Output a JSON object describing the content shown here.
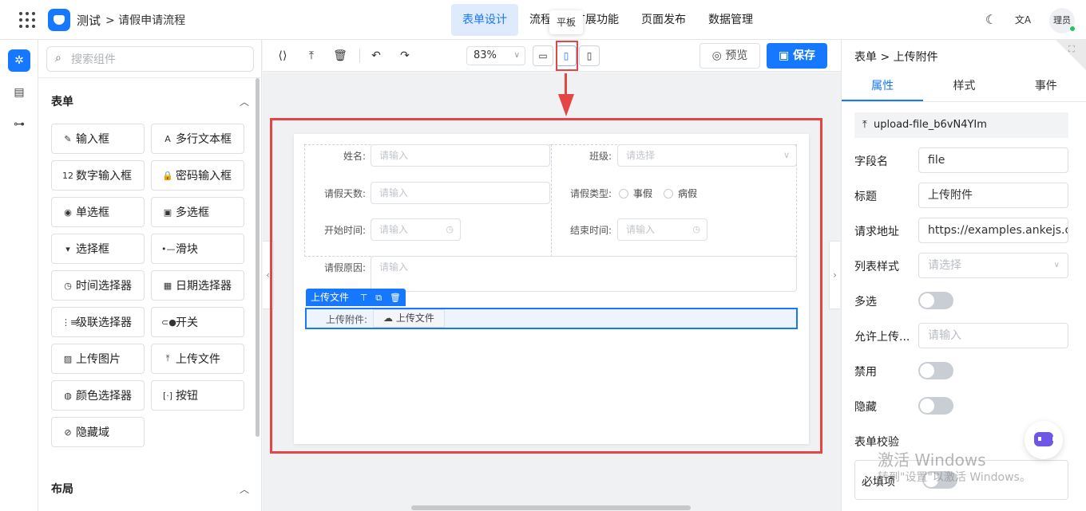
{
  "header": {
    "app_name": "测试",
    "breadcrumb": "> 请假申请流程",
    "nav": [
      "表单设计",
      "流程",
      "扩展功能",
      "页面发布",
      "数据管理"
    ],
    "theme_icon": "☾",
    "lang_icon": "文A",
    "user": "理员",
    "tooltip": "平板"
  },
  "rail": {
    "icons": [
      "puzzle-icon",
      "form-icon",
      "tree-icon"
    ]
  },
  "components": {
    "search_placeholder": "搜索组件",
    "groups": [
      {
        "title": "表单",
        "items": [
          {
            "label": "输入框",
            "icon": "✎"
          },
          {
            "label": "多行文本框",
            "icon": "A"
          },
          {
            "label": "数字输入框",
            "icon": "12"
          },
          {
            "label": "密码输入框",
            "icon": "🔒"
          },
          {
            "label": "单选框",
            "icon": "◉"
          },
          {
            "label": "多选框",
            "icon": "▣"
          },
          {
            "label": "选择框",
            "icon": "▾"
          },
          {
            "label": "滑块",
            "icon": "•—"
          },
          {
            "label": "时间选择器",
            "icon": "◷"
          },
          {
            "label": "日期选择器",
            "icon": "▦"
          },
          {
            "label": "级联选择器",
            "icon": "⋮≡"
          },
          {
            "label": "开关",
            "icon": "⊂●"
          },
          {
            "label": "上传图片",
            "icon": "▨"
          },
          {
            "label": "上传文件",
            "icon": "⤒"
          },
          {
            "label": "颜色选择器",
            "icon": "◍"
          },
          {
            "label": "按钮",
            "icon": "[·]"
          },
          {
            "label": "隐藏域",
            "icon": "⊘"
          }
        ]
      },
      {
        "title": "布局"
      }
    ]
  },
  "toolbar": {
    "zoom": "83%",
    "preview": "预览",
    "save": "保存"
  },
  "form": {
    "name_label": "姓名:",
    "name_ph": "请输入",
    "class_label": "班级:",
    "class_ph": "请选择",
    "days_label": "请假天数:",
    "days_ph": "请输入",
    "type_label": "请假类型:",
    "type_options": [
      "事假",
      "病假"
    ],
    "start_label": "开始时间:",
    "start_ph": "请输入",
    "end_label": "结束时间:",
    "end_ph": "请输入",
    "reason_label": "请假原因:",
    "reason_ph": "请输入",
    "selected_chip": "上传文件",
    "upload_label": "上传附件:",
    "upload_btn": "上传文件"
  },
  "props": {
    "breadcrumb": "表单 > 上传附件",
    "tabs": [
      "属性",
      "样式",
      "事件"
    ],
    "component_id": "upload-file_b6vN4YIm",
    "field_label": "字段名",
    "field_value": "file",
    "title_label": "标题",
    "title_value": "上传附件",
    "url_label": "请求地址",
    "url_value": "https://examples.ankejs.cn/",
    "list_label": "列表样式",
    "list_ph": "请选择",
    "multi_label": "多选",
    "allow_label": "允许上传...",
    "allow_ph": "请输入",
    "disabled_label": "禁用",
    "hidden_label": "隐藏",
    "validation_label": "表单校验",
    "required_label": "必填项"
  },
  "watermark": {
    "line1": "激活 Windows",
    "line2": "转到\"设置\"以激活 Windows。"
  },
  "colors": {
    "accent": "#1677ff",
    "annotation": "#e54545"
  }
}
